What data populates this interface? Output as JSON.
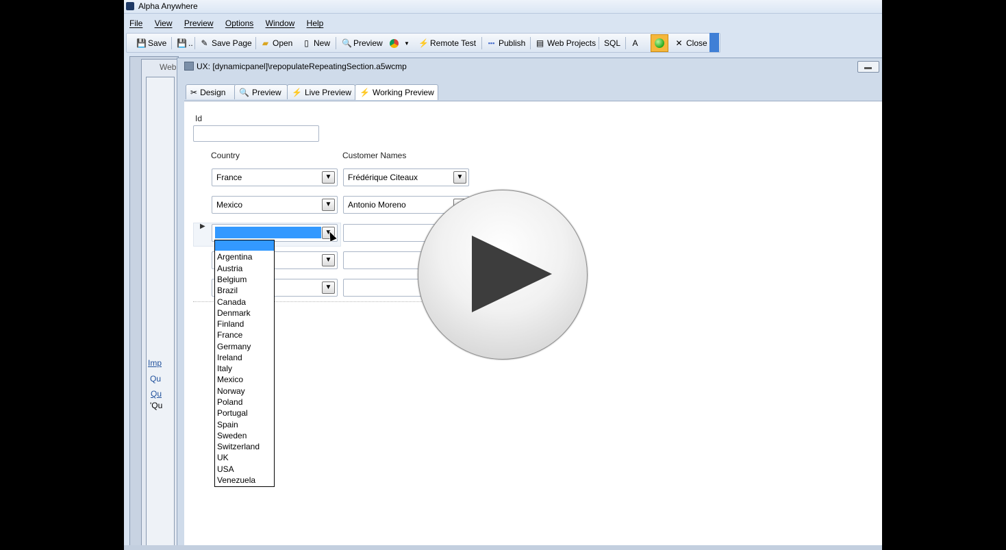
{
  "app": {
    "title": "Alpha Anywhere"
  },
  "menu": [
    "File",
    "View",
    "Preview",
    "Options",
    "Window",
    "Help"
  ],
  "toolbar": {
    "save": "Save",
    "save_all": "..",
    "save_page": "Save Page",
    "open": "Open",
    "new": "New",
    "preview": "Preview",
    "remote_test": "Remote Test",
    "publish": "Publish",
    "web_projects": "Web Projects",
    "sql": "SQL",
    "close": "Close"
  },
  "background": {
    "tab_label": "Web",
    "side_links": [
      "Imp",
      "Qu",
      "Qu",
      "'Qu"
    ]
  },
  "document": {
    "title": "UX: [dynamicpanel]\\repopulateRepeatingSection.a5wcmp",
    "tabs": [
      "Design",
      "Preview",
      "Live Preview",
      "Working Preview"
    ]
  },
  "form": {
    "id_label": "Id",
    "id_value": "",
    "country_header": "Country",
    "customer_header": "Customer Names",
    "rows": [
      {
        "country": "France",
        "customer": "Frédérique Citeaux"
      },
      {
        "country": "Mexico",
        "customer": "Antonio Moreno"
      },
      {
        "country": "",
        "customer": ""
      },
      {
        "country": "",
        "customer": ""
      },
      {
        "country": "",
        "customer": ""
      }
    ]
  },
  "dropdown_options": [
    "Argentina",
    "Austria",
    "Belgium",
    "Brazil",
    "Canada",
    "Denmark",
    "Finland",
    "France",
    "Germany",
    "Ireland",
    "Italy",
    "Mexico",
    "Norway",
    "Poland",
    "Portugal",
    "Spain",
    "Sweden",
    "Switzerland",
    "UK",
    "USA",
    "Venezuela"
  ],
  "colors": {
    "highlight": "#3399ff",
    "accent": "#f5b73b",
    "play_triangle": "#3d3d3d"
  }
}
